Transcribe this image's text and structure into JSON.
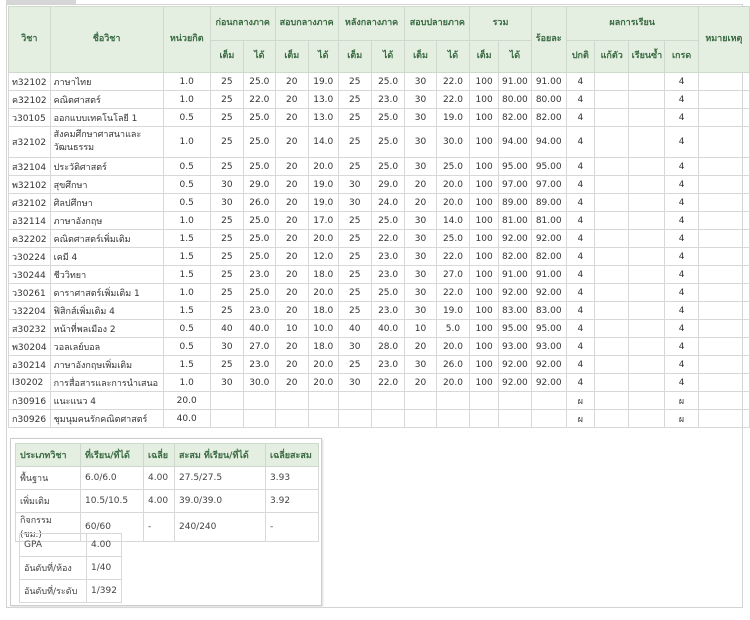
{
  "header": {
    "code": "วิชา",
    "name": "ชื่อวิชา",
    "credit": "หน่วยกิต",
    "groups": [
      "ก่อนกลางภาค",
      "สอบกลางภาค",
      "หลังกลางภาค",
      "สอบปลายภาค",
      "รวม"
    ],
    "percent": "ร้อยละ",
    "result": "ผลการเรียน",
    "remark": "หมายเหตุ",
    "full": "เต็ม",
    "got": "ได้",
    "sub_result": [
      "ปกติ",
      "แก้ตัว",
      "เรียนซ้ำ",
      "เกรด"
    ]
  },
  "rows": [
    [
      "ท32102",
      "ภาษาไทย",
      "1.0",
      "25",
      "25.0",
      "20",
      "19.0",
      "25",
      "25.0",
      "30",
      "22.0",
      "100",
      "91.00",
      "91.00",
      "4",
      "",
      "",
      "4",
      ""
    ],
    [
      "ค32102",
      "คณิตศาสตร์",
      "1.0",
      "25",
      "22.0",
      "20",
      "13.0",
      "25",
      "23.0",
      "30",
      "22.0",
      "100",
      "80.00",
      "80.00",
      "4",
      "",
      "",
      "4",
      ""
    ],
    [
      "ว30105",
      "ออกแบบเทคโนโลยี 1",
      "0.5",
      "25",
      "25.0",
      "20",
      "13.0",
      "25",
      "25.0",
      "30",
      "19.0",
      "100",
      "82.00",
      "82.00",
      "4",
      "",
      "",
      "4",
      ""
    ],
    [
      "ส32102",
      "สังคมศึกษาศาสนาและวัฒนธรรม",
      "1.0",
      "25",
      "25.0",
      "20",
      "14.0",
      "25",
      "25.0",
      "30",
      "30.0",
      "100",
      "94.00",
      "94.00",
      "4",
      "",
      "",
      "4",
      ""
    ],
    [
      "ส32104",
      "ประวัติศาสตร์",
      "0.5",
      "25",
      "25.0",
      "20",
      "20.0",
      "25",
      "25.0",
      "30",
      "25.0",
      "100",
      "95.00",
      "95.00",
      "4",
      "",
      "",
      "4",
      ""
    ],
    [
      "พ32102",
      "สุขศึกษา",
      "0.5",
      "30",
      "29.0",
      "20",
      "19.0",
      "30",
      "29.0",
      "20",
      "20.0",
      "100",
      "97.00",
      "97.00",
      "4",
      "",
      "",
      "4",
      ""
    ],
    [
      "ศ32102",
      "ศิลปศึกษา",
      "0.5",
      "30",
      "26.0",
      "20",
      "19.0",
      "30",
      "24.0",
      "20",
      "20.0",
      "100",
      "89.00",
      "89.00",
      "4",
      "",
      "",
      "4",
      ""
    ],
    [
      "อ32114",
      "ภาษาอังกฤษ",
      "1.0",
      "25",
      "25.0",
      "20",
      "17.0",
      "25",
      "25.0",
      "30",
      "14.0",
      "100",
      "81.00",
      "81.00",
      "4",
      "",
      "",
      "4",
      ""
    ],
    [
      "ค32202",
      "คณิตศาสตร์เพิ่มเติม",
      "1.5",
      "25",
      "25.0",
      "20",
      "20.0",
      "25",
      "22.0",
      "30",
      "25.0",
      "100",
      "92.00",
      "92.00",
      "4",
      "",
      "",
      "4",
      ""
    ],
    [
      "ว30224",
      "เคมี 4",
      "1.5",
      "25",
      "25.0",
      "20",
      "12.0",
      "25",
      "23.0",
      "30",
      "22.0",
      "100",
      "82.00",
      "82.00",
      "4",
      "",
      "",
      "4",
      ""
    ],
    [
      "ว30244",
      "ชีววิทยา",
      "1.5",
      "25",
      "23.0",
      "20",
      "18.0",
      "25",
      "23.0",
      "30",
      "27.0",
      "100",
      "91.00",
      "91.00",
      "4",
      "",
      "",
      "4",
      ""
    ],
    [
      "ว30261",
      "ดาราศาสตร์เพิ่มเติม 1",
      "1.0",
      "25",
      "25.0",
      "20",
      "20.0",
      "25",
      "25.0",
      "30",
      "22.0",
      "100",
      "92.00",
      "92.00",
      "4",
      "",
      "",
      "4",
      ""
    ],
    [
      "ว32204",
      "ฟิสิกส์เพิ่มเติม 4",
      "1.5",
      "25",
      "23.0",
      "20",
      "18.0",
      "25",
      "23.0",
      "30",
      "19.0",
      "100",
      "83.00",
      "83.00",
      "4",
      "",
      "",
      "4",
      ""
    ],
    [
      "ส30232",
      "หน้าที่พลเมือง 2",
      "0.5",
      "40",
      "40.0",
      "10",
      "10.0",
      "40",
      "40.0",
      "10",
      "5.0",
      "100",
      "95.00",
      "95.00",
      "4",
      "",
      "",
      "4",
      ""
    ],
    [
      "พ30204",
      "วอลเลย์บอล",
      "0.5",
      "30",
      "27.0",
      "20",
      "18.0",
      "30",
      "28.0",
      "20",
      "20.0",
      "100",
      "93.00",
      "93.00",
      "4",
      "",
      "",
      "4",
      ""
    ],
    [
      "อ30214",
      "ภาษาอังกฤษเพิ่มเติม",
      "1.5",
      "25",
      "23.0",
      "20",
      "20.0",
      "25",
      "23.0",
      "30",
      "26.0",
      "100",
      "92.00",
      "92.00",
      "4",
      "",
      "",
      "4",
      ""
    ],
    [
      "I30202",
      "การสื่อสารและการนำเสนอ",
      "1.0",
      "30",
      "30.0",
      "20",
      "20.0",
      "30",
      "22.0",
      "20",
      "20.0",
      "100",
      "92.00",
      "92.00",
      "4",
      "",
      "",
      "4",
      ""
    ],
    [
      "ก30916",
      "แนะแนว 4",
      "20.0",
      "",
      "",
      "",
      "",
      "",
      "",
      "",
      "",
      "",
      "",
      "",
      "ผ",
      "",
      "",
      "ผ",
      ""
    ],
    [
      "ก30926",
      "ชุมนุมคนรักคณิตศาสตร์",
      "40.0",
      "",
      "",
      "",
      "",
      "",
      "",
      "",
      "",
      "",
      "",
      "",
      "ผ",
      "",
      "",
      "ผ",
      ""
    ]
  ],
  "summary": {
    "headers": [
      "ประเภทวิชา",
      "ที่เรียน/ที่ได้",
      "เฉลี่ย",
      "สะสม ที่เรียน/ที่ได้",
      "เฉลี่ยสะสม"
    ],
    "rows": [
      [
        "พื้นฐาน",
        "6.0/6.0",
        "4.00",
        "27.5/27.5",
        "3.93"
      ],
      [
        "เพิ่มเติม",
        "10.5/10.5",
        "4.00",
        "39.0/39.0",
        "3.92"
      ],
      [
        "กิจกรรม (ชม.)",
        "60/60",
        "-",
        "240/240",
        "-"
      ]
    ],
    "gpa": [
      [
        "GPA",
        "4.00"
      ],
      [
        "อันดับที่/ห้อง",
        "1/40"
      ],
      [
        "อันดับที่/ระดับ",
        "1/392"
      ]
    ]
  }
}
